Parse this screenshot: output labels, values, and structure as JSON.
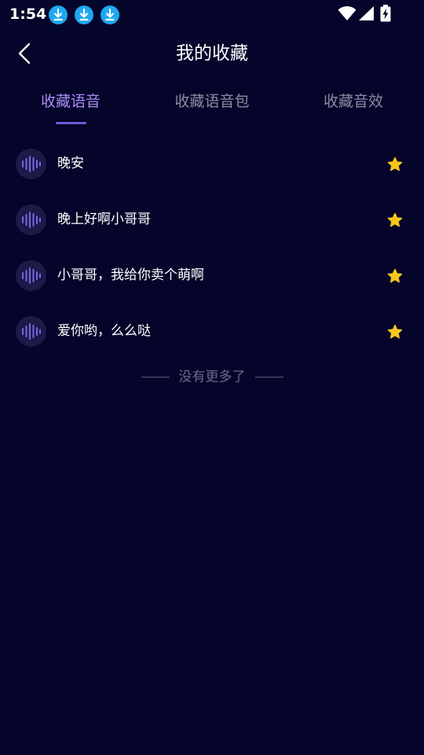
{
  "status_bar": {
    "time": "1:54",
    "notifications": [
      "download-icon",
      "download-icon",
      "download-icon"
    ],
    "icons": [
      "wifi-icon",
      "cell-signal-icon",
      "battery-charging-icon"
    ]
  },
  "header": {
    "back_icon": "chevron-left-icon",
    "title": "我的收藏"
  },
  "tabs": [
    {
      "label": "收藏语音",
      "active": true
    },
    {
      "label": "收藏语音包",
      "active": false
    },
    {
      "label": "收藏音效",
      "active": false
    }
  ],
  "items": [
    {
      "title": "晚安",
      "icon": "sound-wave-icon",
      "favorited": true
    },
    {
      "title": "晚上好啊小哥哥",
      "icon": "sound-wave-icon",
      "favorited": true
    },
    {
      "title": "小哥哥，我给你卖个萌啊",
      "icon": "sound-wave-icon",
      "favorited": true
    },
    {
      "title": "爱你哟，么么哒",
      "icon": "sound-wave-icon",
      "favorited": true
    }
  ],
  "footer": {
    "no_more_text": "没有更多了"
  },
  "colors": {
    "background": "#05042a",
    "accent": "#a98cf5",
    "indicator": "#6f58d8",
    "star": "#f7c51e",
    "wave": "#7b63e6",
    "download_badge": "#1ea7f0"
  }
}
